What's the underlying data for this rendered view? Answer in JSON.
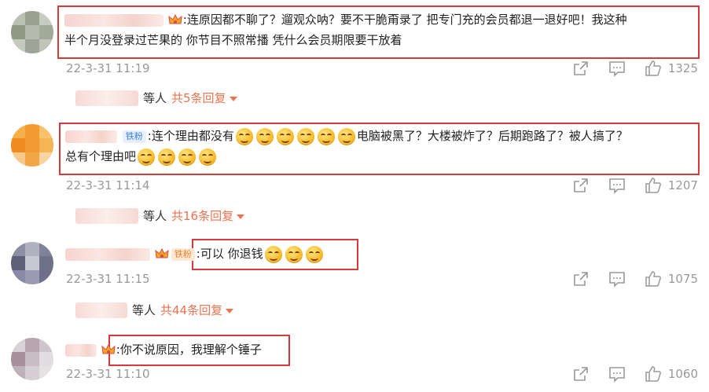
{
  "comments": [
    {
      "text_line1": ":连原因都不聊了？遛观众呐？要不干脆甭录了 把专门充的会员都退一退好吧！我这种",
      "text_line2": "半个月没登录过芒果的 你节目不照常播 凭什么会员期限要干放着",
      "timestamp": "22-3-31 11:19",
      "like_count": "1325",
      "replies_others": "等人",
      "replies_more": "共5条回复"
    },
    {
      "fans_badge": "铁粉",
      "text_line1a": ":连个理由都没有",
      "text_line1b": "电脑被黑了？大楼被炸了？后期跑路了？被人搞了？",
      "text_line2": "总有个理由吧",
      "timestamp": "22-3-31 11:14",
      "like_count": "1207",
      "replies_others": "等人",
      "replies_more": "共16条回复"
    },
    {
      "fans_badge": "铁粉",
      "text": ":可以 你退钱",
      "timestamp": "22-3-31 11:15",
      "like_count": "1075",
      "replies_others": "等人",
      "replies_more": "共44条回复"
    },
    {
      "text": ":你不说原因，我理解个锤子",
      "timestamp": "22-3-31 11:10",
      "like_count": "1060"
    }
  ],
  "colors": {
    "highlight_box": "#d9393b",
    "reply_link": "#eb7350",
    "meta_gray": "#999999"
  },
  "icons": [
    "share-icon",
    "comment-icon",
    "like-icon",
    "crown-icon",
    "smile-emoji-icon",
    "chevron-down-icon"
  ]
}
